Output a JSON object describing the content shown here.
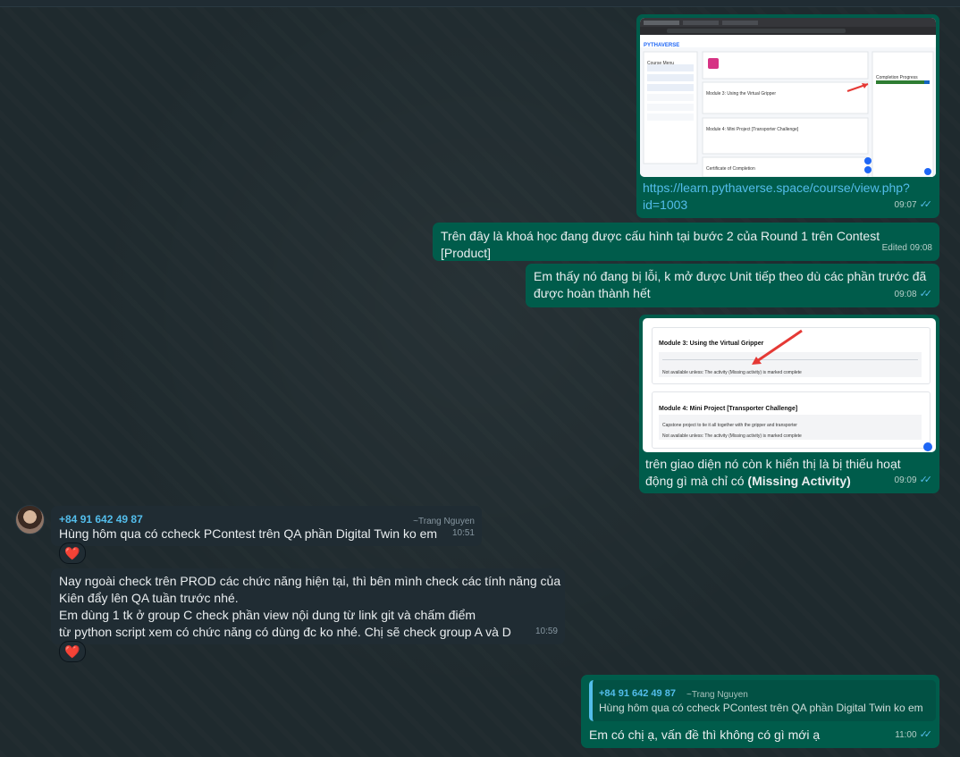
{
  "messages": {
    "m1": {
      "link_line1": "https://learn.pythaverse.space/course/view.php?",
      "link_line2": "id=1003",
      "time": "09:07",
      "thumb": {
        "brand": "PYTHAVERSE",
        "course_menu": "Course Menu",
        "module3": "Module 3: Using the Virtual Gripper",
        "module4": "Module 4: Mini Project [Transporter Challenge]",
        "certificate": "Certificate of Completion",
        "progress": "Completion Progress"
      }
    },
    "m2": {
      "text": "Trên đây là khoá học đang được cấu hình tại bước 2 của Round 1 trên Contest [Product]",
      "edited": "Edited",
      "time": "09:08"
    },
    "m3": {
      "line1": "Em thấy nó đang bị lỗi, k mở được Unit tiếp theo dù các phần trước đã",
      "line2": "được hoàn thành hết",
      "time": "09:08"
    },
    "m4": {
      "line1": "trên giao diện nó còn k hiển thị là bị thiếu hoạt",
      "line2_prefix": "động gì mà chỉ có ",
      "line2_bold": "(Missing Activity)",
      "time": "09:09",
      "thumb": {
        "module3": "Module 3: Using the Virtual Gripper",
        "module3_note": "Not available unless: The activity (Missing activity) is marked complete",
        "module4": "Module 4: Mini Project [Transporter Challenge]",
        "module4_desc": "Capstone project to tie it all together with the gripper and transporter",
        "module4_note": "Not available unless: The activity (Missing activity) is marked complete"
      }
    },
    "m5": {
      "sender": "+84 91 642 49 87",
      "alias": "~Trang Nguyen",
      "text": "Hùng hôm qua có ccheck PContest trên QA phần Digital Twin ko em",
      "time": "10:51",
      "reaction": "❤️"
    },
    "m6": {
      "lines": [
        "Nay ngoài check trên PROD các chức năng hiện tại, thì bên mình check các tính năng của",
        "Kiên đẩy lên QA tuần trước nhé.",
        "Em dùng 1 tk ở group C check phần view nội dung từ link git và chấm điểm",
        "từ python script xem có chức năng có dùng đc ko nhé. Chị sẽ check group A và D"
      ],
      "time": "10:59",
      "reaction": "❤️"
    },
    "m7": {
      "quote_sender": "+84 91 642 49 87",
      "quote_alias": "~Trang Nguyen",
      "quote_text": "Hùng hôm qua có ccheck PContest trên QA phần Digital Twin ko em",
      "text": "Em có chị ạ, vấn đề thì không có gì mới ạ",
      "time": "11:00"
    }
  },
  "icons": {
    "read": "double-check-icon",
    "reaction": "heart-icon",
    "arrow": "red-arrow-icon"
  },
  "colors": {
    "outgoing": "#005c4b",
    "incoming": "#202c33",
    "link": "#53bdeb",
    "ticks": "#53bdeb"
  }
}
